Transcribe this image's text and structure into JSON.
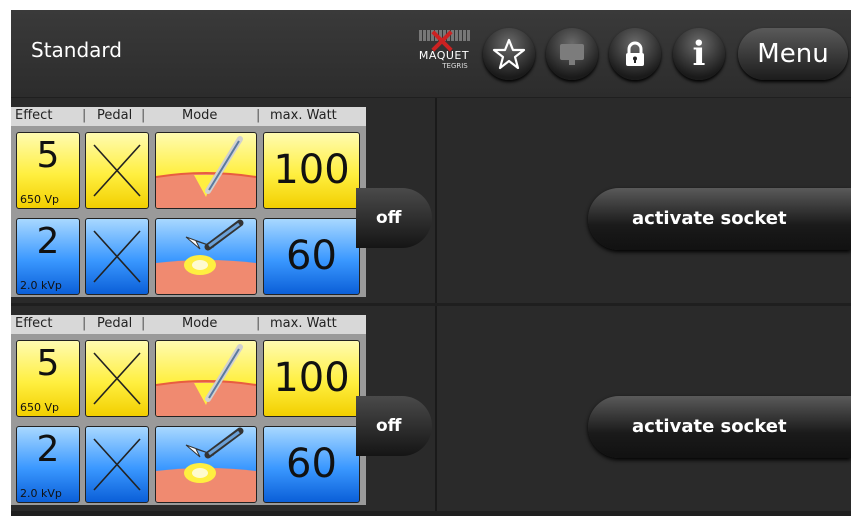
{
  "header": {
    "title": "Standard",
    "logo": {
      "brand": "MAQUET",
      "sub": "TEGRIS"
    },
    "buttons": {
      "favorites_icon": "star-icon",
      "display_icon": "monitor-icon",
      "lock_icon": "lock-icon",
      "info_icon": "info-icon",
      "info_glyph": "i",
      "menu_label": "Menu"
    }
  },
  "columns": {
    "effect": "Effect",
    "pedal": "Pedal",
    "mode": "Mode",
    "watt": "max. Watt"
  },
  "sockets": [
    {
      "channels": [
        {
          "color": "yellow",
          "effect": "5",
          "effect_sub": "650 Vp",
          "pedal": "none",
          "mode_icon": "cut-mode-icon",
          "max_watt": "100"
        },
        {
          "color": "blue",
          "effect": "2",
          "effect_sub": "2.0 kVp",
          "pedal": "none",
          "mode_icon": "coag-spark-mode-icon",
          "max_watt": "60"
        }
      ],
      "off_label": "off",
      "activate_label": "activate socket"
    },
    {
      "channels": [
        {
          "color": "yellow",
          "effect": "5",
          "effect_sub": "650 Vp",
          "pedal": "none",
          "mode_icon": "cut-mode-icon",
          "max_watt": "100"
        },
        {
          "color": "blue",
          "effect": "2",
          "effect_sub": "2.0 kVp",
          "pedal": "none",
          "mode_icon": "coag-spark-mode-icon",
          "max_watt": "60"
        }
      ],
      "off_label": "off",
      "activate_label": "activate socket"
    }
  ],
  "colors": {
    "yellow_channel": "#ffef40",
    "blue_channel": "#3a98ff",
    "background": "#2a2a2a",
    "logo_cross": "#cc2222"
  }
}
